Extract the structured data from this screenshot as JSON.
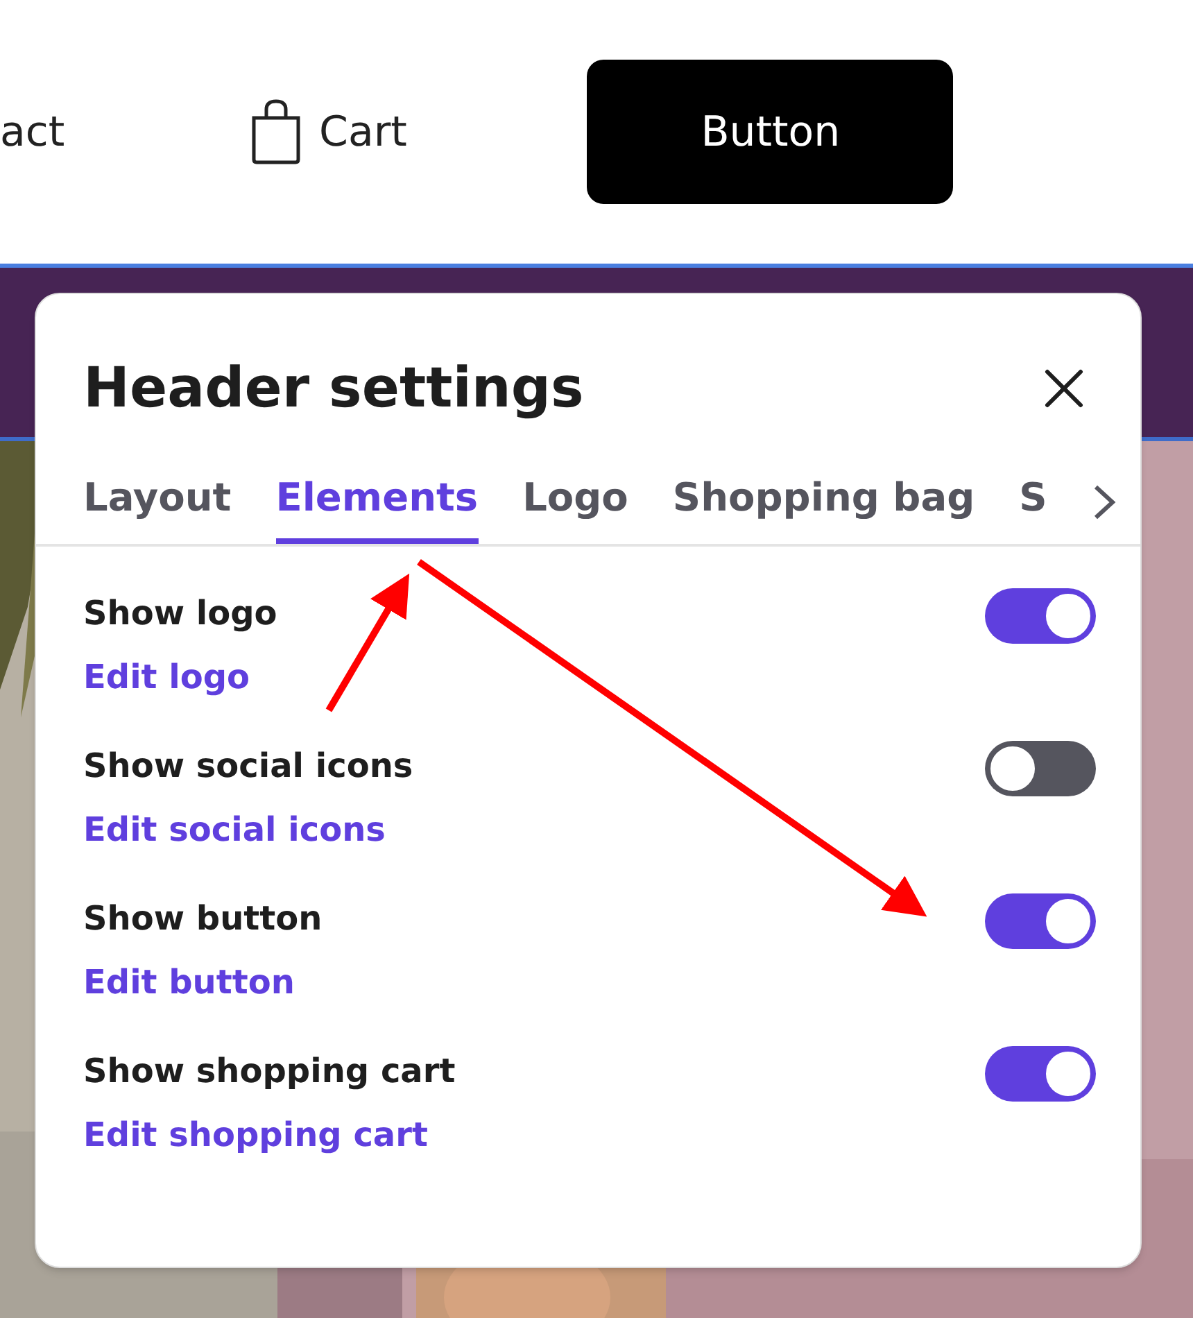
{
  "site_header": {
    "nav_link": "act",
    "cart_label": "Cart",
    "button_label": "Button"
  },
  "dialog": {
    "title": "Header settings",
    "tabs": [
      {
        "label": "Layout",
        "selected": false
      },
      {
        "label": "Elements",
        "selected": true
      },
      {
        "label": "Logo",
        "selected": false
      },
      {
        "label": "Shopping bag",
        "selected": false
      },
      {
        "label": "S",
        "selected": false
      }
    ],
    "settings": [
      {
        "label": "Show logo",
        "link": "Edit logo",
        "on": true
      },
      {
        "label": "Show social icons",
        "link": "Edit social icons",
        "on": false
      },
      {
        "label": "Show button",
        "link": "Edit button",
        "on": true
      },
      {
        "label": "Show shopping cart",
        "link": "Edit shopping cart",
        "on": true
      }
    ]
  }
}
